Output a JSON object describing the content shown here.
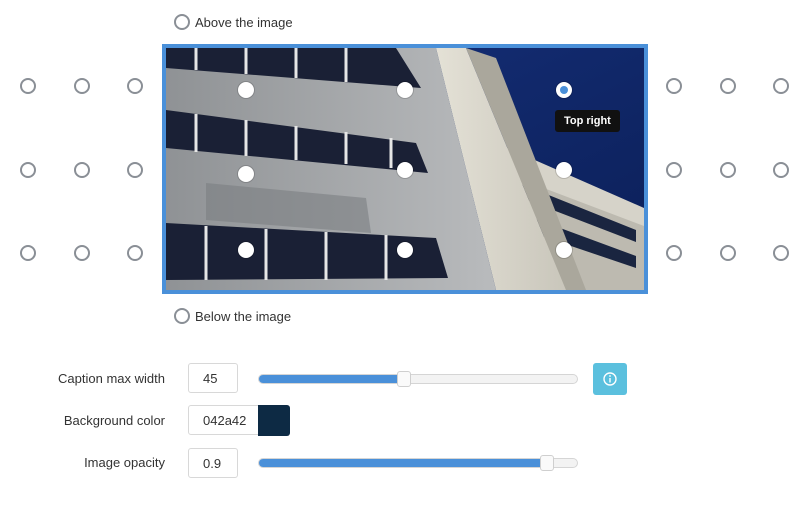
{
  "position_options": {
    "above_label": "Above the image",
    "below_label": "Below the image",
    "selected": "Top right"
  },
  "image": {
    "description_icon": "building-photo",
    "tooltip": "Top right"
  },
  "settings": {
    "caption_max_width": {
      "label": "Caption max width",
      "value": "45",
      "slider_fraction": 0.45
    },
    "background_color": {
      "label": "Background color",
      "value": "042a42",
      "swatch_color": "#0d2a44"
    },
    "image_opacity": {
      "label": "Image opacity",
      "value": "0.9",
      "slider_fraction": 0.9
    }
  },
  "colors": {
    "accent": "#4a90d9",
    "info": "#5bc0de"
  }
}
